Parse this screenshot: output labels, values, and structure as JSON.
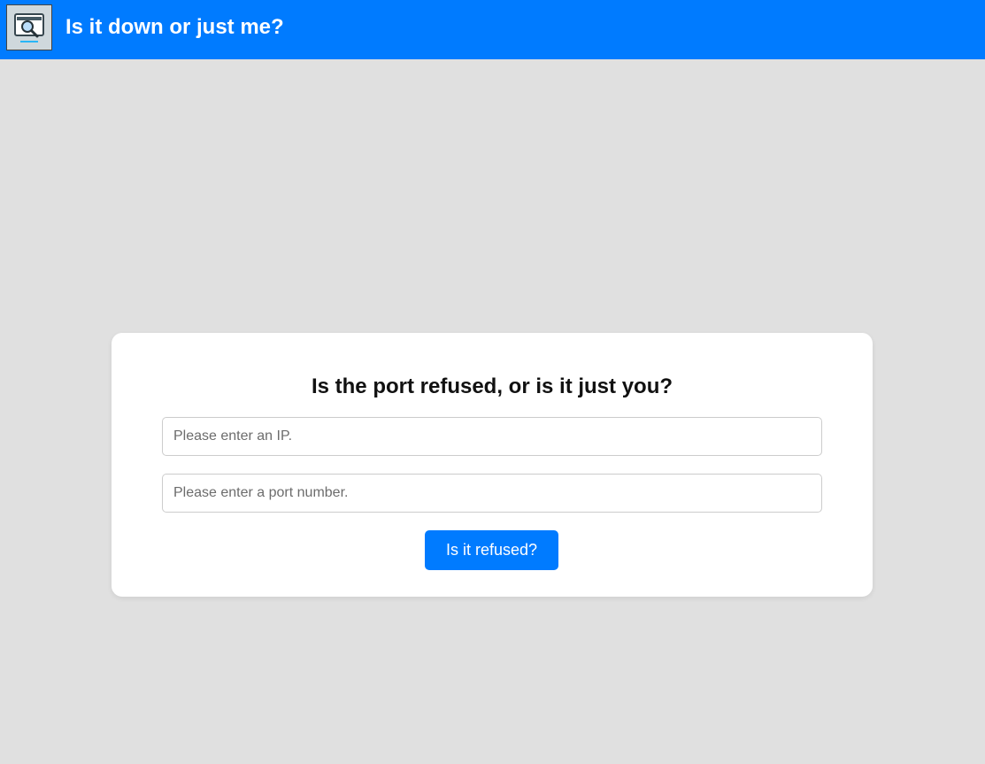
{
  "header": {
    "app_title": "Is it down or just me?",
    "logo_icon": "monitor-search-icon",
    "accent_color": "#007bff"
  },
  "form": {
    "title": "Is the port refused, or is it just you?",
    "ip_placeholder": "Please enter an IP.",
    "ip_value": "",
    "port_placeholder": "Please enter a port number.",
    "port_value": "",
    "submit_label": "Is it refused?"
  }
}
